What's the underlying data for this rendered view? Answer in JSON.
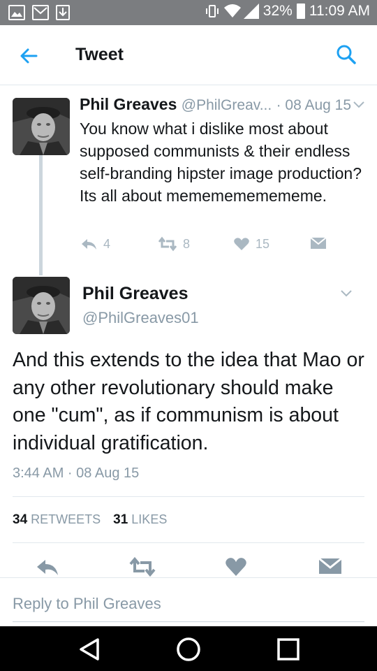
{
  "status_bar": {
    "battery": "32%",
    "time": "11:09 AM",
    "icons": [
      "picture-icon",
      "mail-icon",
      "download-icon",
      "vibrate-icon",
      "wifi-icon",
      "signal-icon",
      "battery-icon"
    ]
  },
  "header": {
    "title": "Tweet",
    "back_icon": "arrow-left-icon",
    "search_icon": "search-icon",
    "accent": "#1da1f2"
  },
  "parent_tweet": {
    "name": "Phil Greaves",
    "handle": "@PhilGreav...",
    "date": "· 08 Aug 15",
    "text": "You know what i dislike most about supposed communists & their endless self-branding hipster image production? Its all about mememememememe.",
    "replies": "4",
    "retweets": "8",
    "likes": "15"
  },
  "main_tweet": {
    "name": "Phil Greaves",
    "handle": "@PhilGreaves01",
    "text": "And this extends to the idea that Mao or any other revolutionary should make one \"cum\", as if communism is about individual gratification.",
    "timestamp": "3:44 AM · 08 Aug 15",
    "retweet_count": "34",
    "retweet_label": "RETWEETS",
    "like_count": "31",
    "like_label": "LIKES"
  },
  "reply_bar": {
    "placeholder": "Reply to Phil Greaves"
  },
  "nav_bar": {
    "icons": [
      "back-triangle-icon",
      "home-circle-icon",
      "recents-square-icon"
    ]
  }
}
